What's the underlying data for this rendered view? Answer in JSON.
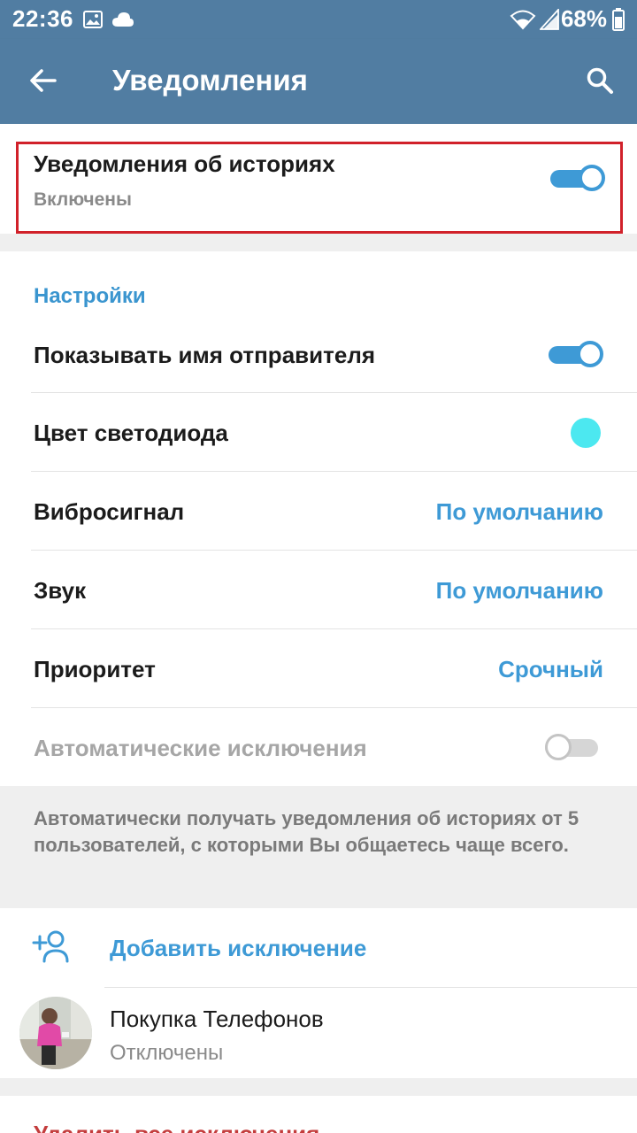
{
  "status_bar": {
    "time": "22:36",
    "battery": "68%",
    "icons": [
      "image-icon",
      "cloud-icon",
      "wifi-icon",
      "signal-icon",
      "battery-icon"
    ]
  },
  "app_bar": {
    "title": "Уведомления",
    "back_icon": "arrow-left-icon",
    "search_icon": "search-icon",
    "background": "#517da2"
  },
  "story_notifications": {
    "title": "Уведомления об историях",
    "status": "Включены",
    "enabled": true
  },
  "settings": {
    "header": "Настройки",
    "show_sender": {
      "label": "Показывать имя отправителя",
      "enabled": true
    },
    "led_color": {
      "label": "Цвет светодиода",
      "color": "#4ce8f0"
    },
    "vibration": {
      "label": "Вибросигнал",
      "value": "По умолчанию"
    },
    "sound": {
      "label": "Звук",
      "value": "По умолчанию"
    },
    "priority": {
      "label": "Приоритет",
      "value": "Срочный"
    },
    "auto_exceptions": {
      "label": "Автоматические исключения",
      "enabled": false
    }
  },
  "info_text": "Автоматически получать уведомления об историях от 5 пользователей, с которыми Вы общаетесь чаще всего.",
  "exceptions": {
    "add_label": "Добавить исключение",
    "add_icon": "add-user-icon",
    "items": [
      {
        "name": "Покупка Телефонов",
        "status": "Отключены"
      }
    ]
  },
  "delete_all_label": "Удалить все исключения",
  "colors": {
    "accent": "#3e9ad6",
    "highlight": "#d1212a",
    "danger": "#c33c3c"
  }
}
